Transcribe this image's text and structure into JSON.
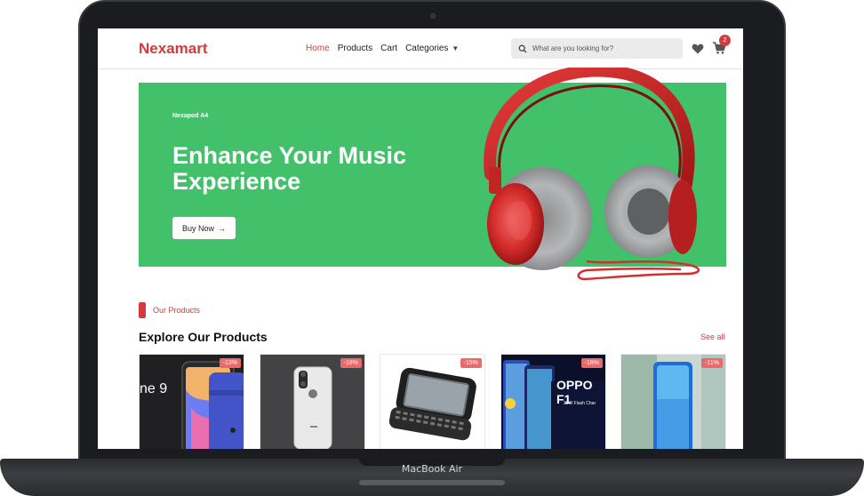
{
  "device": {
    "label": "MacBook Air"
  },
  "navbar": {
    "brand": "Nexamart",
    "links": [
      {
        "label": "Home",
        "active": true
      },
      {
        "label": "Products",
        "active": false
      },
      {
        "label": "Cart",
        "active": false
      },
      {
        "label": "Categories",
        "active": false
      }
    ],
    "search_placeholder": "What are you looking for?",
    "cart_count": "2"
  },
  "hero": {
    "kicker": "Nexapod A4",
    "title": "Enhance Your Music Experience",
    "button_label": "Buy Now",
    "bg_color": "#43c06a"
  },
  "section": {
    "label": "Our Products",
    "title": "Explore Our Products",
    "see_all": "See all"
  },
  "products": [
    {
      "discount": "-13%",
      "image": "iphone-9-purple",
      "caption": "ne 9"
    },
    {
      "discount": "-18%",
      "image": "iphone-x-silver"
    },
    {
      "discount": "-15%",
      "image": "qwerty-slider-phone"
    },
    {
      "discount": "-18%",
      "image": "oppo-f19-phones",
      "caption": "OPPO F1",
      "caption2": "33W Flash Char"
    },
    {
      "discount": "-11%",
      "image": "huawei-p30-blue"
    }
  ],
  "colors": {
    "accent": "#d63a3a",
    "hero_bg": "#43c06a",
    "badge": "#e76b6b"
  }
}
